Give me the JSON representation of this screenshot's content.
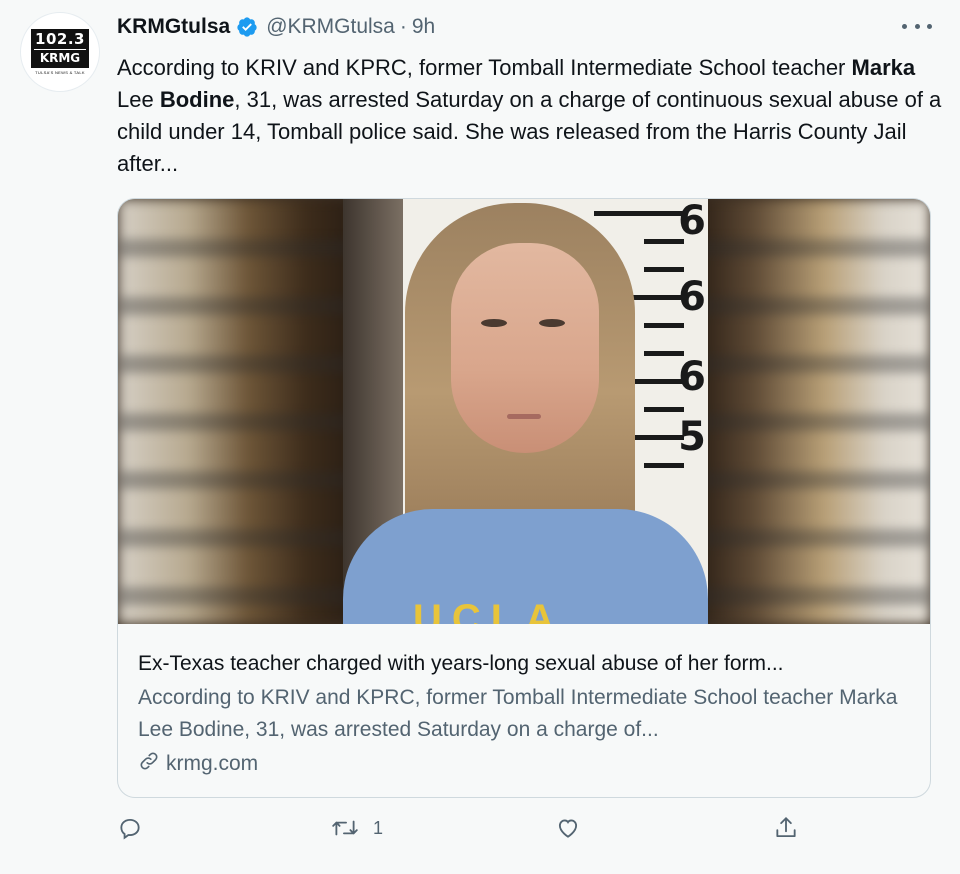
{
  "avatar": {
    "number": "102.3",
    "callsign": "KRMG",
    "tagline": "TULSA'S NEWS & TALK"
  },
  "header": {
    "name": "KRMGtulsa",
    "handle": "@KRMGtulsa",
    "separator": "·",
    "time": "9h"
  },
  "tweet": {
    "line1": "According to KRIV and KPRC, former Tomball Intermediate School teacher",
    "bold1": "Marka",
    "mid1": " Lee ",
    "bold2": "Bodine",
    "line2_rest": ", 31, was arrested Saturday on a charge of continuous sexual abuse of a child under 14, Tomball police said. She was released from the Harris County Jail after..."
  },
  "card": {
    "ruler_numbers": [
      "6",
      "6",
      "6",
      "5"
    ],
    "shirt_text": "UCLA",
    "title": "Ex-Texas teacher charged with years-long sexual abuse of her form...",
    "description": "According to KRIV and KPRC, former Tomball Intermediate School teacher Marka Lee Bodine, 31, was arrested Saturday on a charge of...",
    "domain": "krmg.com"
  },
  "actions": {
    "reply_count": "",
    "retweet_count": "1",
    "like_count": "",
    "share_count": ""
  },
  "icons": {
    "verified": "verified-badge-icon",
    "more": "more-icon",
    "link": "link-icon",
    "reply": "reply-icon",
    "retweet": "retweet-icon",
    "like": "heart-icon",
    "share": "share-icon"
  },
  "colors": {
    "accent": "#1d9bf0",
    "secondary_text": "#536471",
    "border": "#cfd9de"
  }
}
